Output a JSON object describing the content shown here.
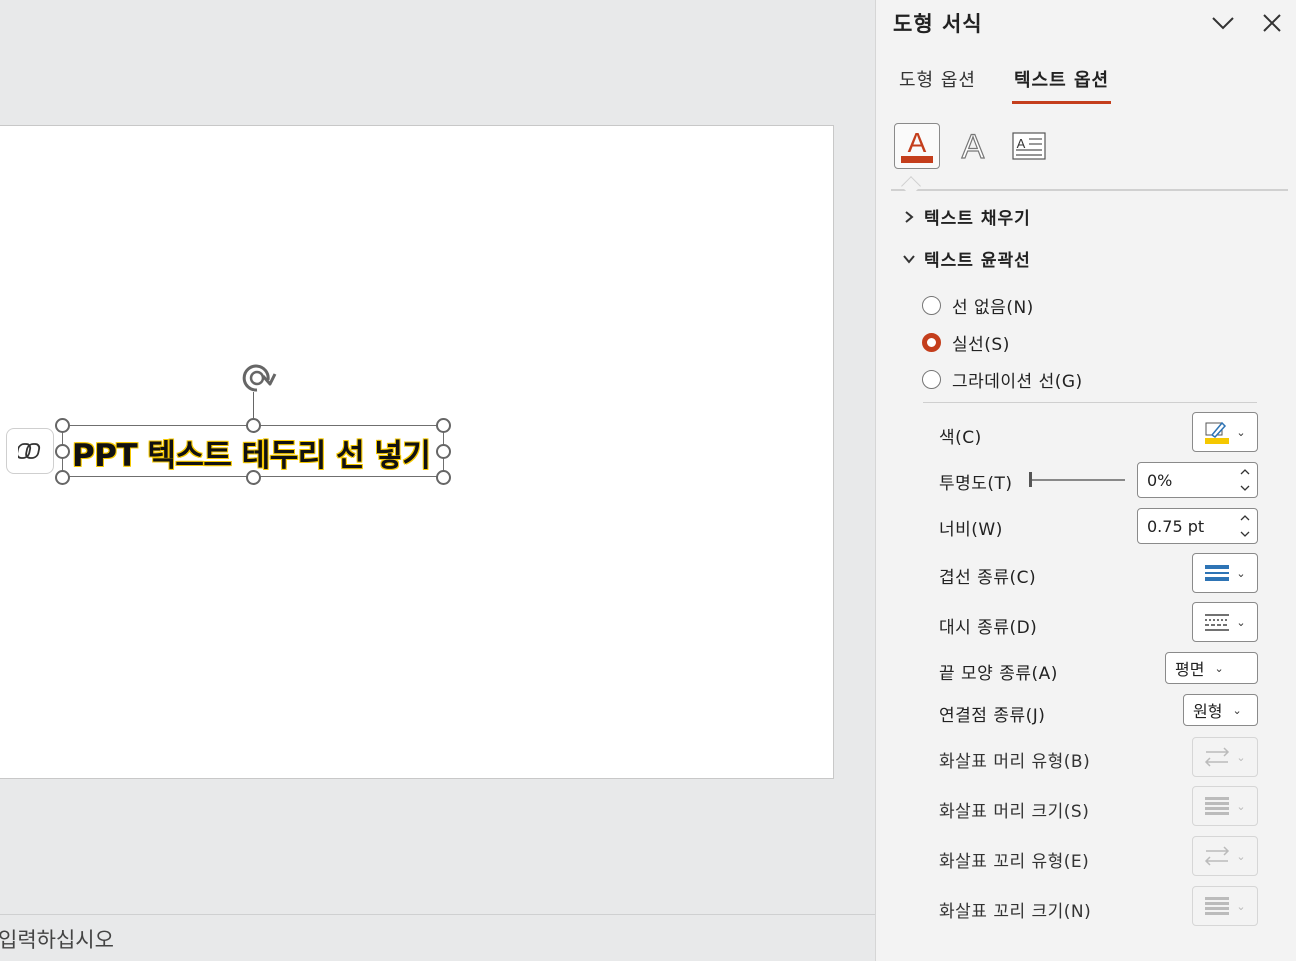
{
  "canvas": {
    "slide_text": "PPT 텍스트 테두리 선 넣기",
    "notes_placeholder": "입력하십시오"
  },
  "pane": {
    "title": "도형 서식",
    "tabs": [
      {
        "label": "도형 옵션",
        "active": false
      },
      {
        "label": "텍스트 옵션",
        "active": true
      }
    ],
    "icon_tabs": [
      "text-fill-outline-icon",
      "text-effects-icon",
      "text-box-icon"
    ],
    "sections": {
      "fill": {
        "label": "텍스트 채우기",
        "expanded": false
      },
      "outline": {
        "label": "텍스트 윤곽선",
        "expanded": true
      }
    },
    "radios": [
      {
        "label": "선 없음(N)",
        "checked": false
      },
      {
        "label": "실선(S)",
        "checked": true
      },
      {
        "label": "그라데이션 선(G)",
        "checked": false
      }
    ],
    "props": {
      "color_label": "색(C)",
      "transparency_label": "투명도(T)",
      "transparency_value": "0%",
      "transparency_level": 0,
      "width_label": "너비(W)",
      "width_value": "0.75 pt",
      "compound_label": "겹선 종류(C)",
      "dash_label": "대시 종류(D)",
      "cap_label": "끝 모양 종류(A)",
      "cap_value": "평면",
      "join_label": "연결점 종류(J)",
      "join_value": "원형",
      "begin_arrow_type_label": "화살표 머리 유형(B)",
      "begin_arrow_size_label": "화살표 머리 크기(S)",
      "end_arrow_type_label": "화살표 꼬리 유형(E)",
      "end_arrow_size_label": "화살표 꼬리 크기(N)"
    },
    "colors": {
      "accent": "#c43e1c",
      "outline_color": "#f5c800",
      "line_blue": "#2e74b5"
    }
  }
}
